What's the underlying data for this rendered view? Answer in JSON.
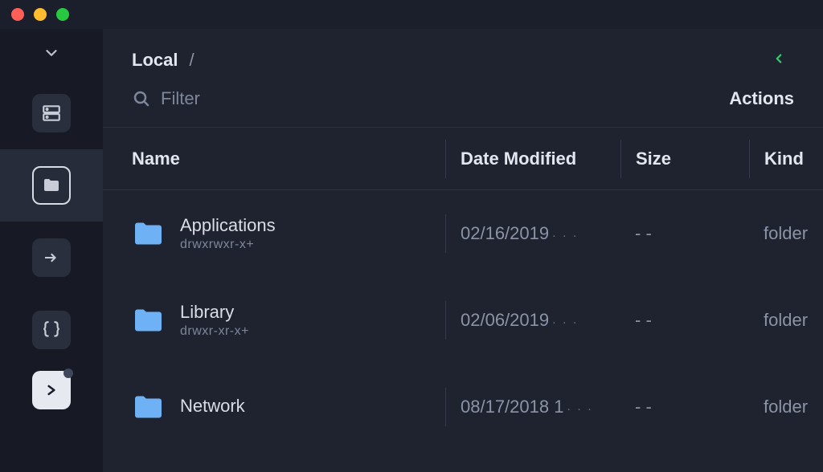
{
  "breadcrumb": {
    "location_label": "Local",
    "path": "/"
  },
  "filter": {
    "placeholder": "Filter"
  },
  "actions_label": "Actions",
  "columns": {
    "name": "Name",
    "date_modified": "Date Modified",
    "size": "Size",
    "kind": "Kind"
  },
  "rows": [
    {
      "name": "Applications",
      "permissions": "drwxrwxr-x+",
      "date_modified": "02/16/2019",
      "date_ellipsis": ". . .",
      "size": "- -",
      "kind": "folder"
    },
    {
      "name": "Library",
      "permissions": "drwxr-xr-x+",
      "date_modified": "02/06/2019",
      "date_ellipsis": ". . .",
      "size": "- -",
      "kind": "folder"
    },
    {
      "name": "Network",
      "permissions": "",
      "date_modified": "08/17/2018 1",
      "date_ellipsis": ". . .",
      "size": "- -",
      "kind": "folder"
    }
  ],
  "colors": {
    "accent_green": "#2ecc71",
    "folder_blue": "#6fb1f5"
  }
}
